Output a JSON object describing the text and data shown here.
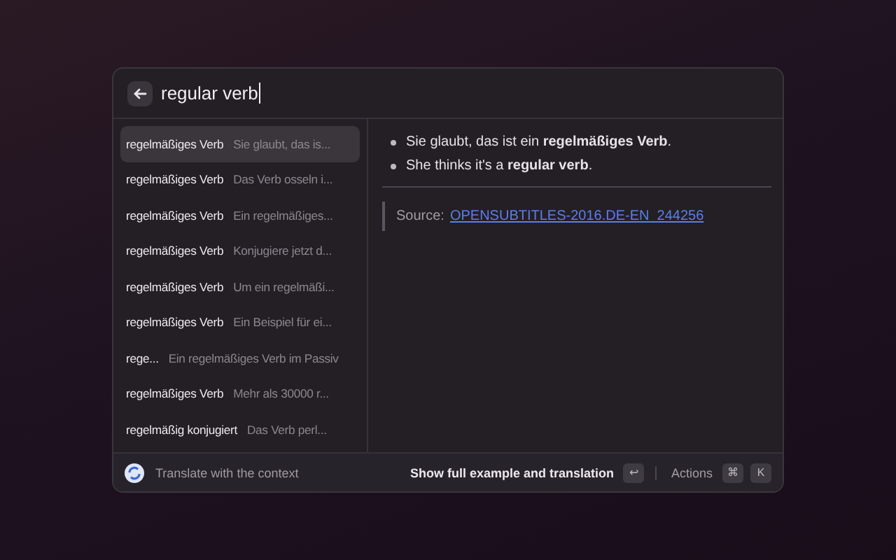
{
  "search": {
    "value": "regular verb"
  },
  "results": [
    {
      "term": "regelmäßiges Verb",
      "snippet": "Sie glaubt, das is...",
      "selected": true
    },
    {
      "term": "regelmäßiges Verb",
      "snippet": "Das Verb osseln i...",
      "selected": false
    },
    {
      "term": "regelmäßiges Verb",
      "snippet": "Ein regelmäßiges...",
      "selected": false
    },
    {
      "term": "regelmäßiges Verb",
      "snippet": "Konjugiere jetzt d...",
      "selected": false
    },
    {
      "term": "regelmäßiges Verb",
      "snippet": "Um ein regelmäßi...",
      "selected": false
    },
    {
      "term": "regelmäßiges Verb",
      "snippet": "Ein Beispiel für ei...",
      "selected": false
    },
    {
      "term": "rege...",
      "snippet": "Ein regelmäßiges Verb im Passiv",
      "selected": false
    },
    {
      "term": "regelmäßiges Verb",
      "snippet": "Mehr als 30000 r...",
      "selected": false
    },
    {
      "term": "regelmäßig konjugiert",
      "snippet": "Das Verb perl...",
      "selected": false
    }
  ],
  "detail": {
    "sentences": [
      "Sie glaubt, das ist ein **regelmäßiges Verb**.",
      "She thinks it's a **regular verb**."
    ],
    "source_label": "Source:",
    "source_link": "OPENSUBTITLES-2016.DE-EN_244256"
  },
  "footer": {
    "title": "Translate with the context",
    "primary_action": "Show full example and translation",
    "primary_key": "↩",
    "actions_label": "Actions",
    "actions_keys": [
      "⌘",
      "K"
    ]
  }
}
